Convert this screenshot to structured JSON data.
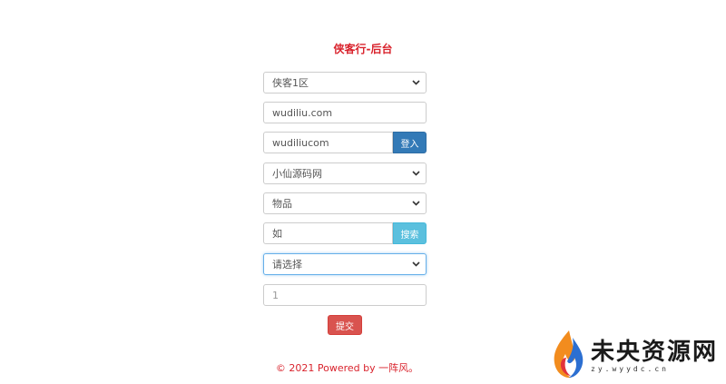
{
  "page": {
    "title": "侠客行-后台"
  },
  "form": {
    "server_select": {
      "value": "侠客1区"
    },
    "site_input": {
      "value": "wudiliu.com"
    },
    "account_input": {
      "value": "wudiliucom"
    },
    "login_button": "登入",
    "role_select": {
      "value": "小仙源码网"
    },
    "category_select": {
      "value": "物品"
    },
    "search_input": {
      "value": "如"
    },
    "search_button": "搜索",
    "item_select": {
      "value": "请选择"
    },
    "quantity_input": {
      "placeholder": "1"
    },
    "submit_button": "提交"
  },
  "footer": {
    "text": "© 2021 Powered by 一阵风。"
  },
  "watermark": {
    "title": "未央资源网",
    "subtitle": "zy.wyydc.cn"
  },
  "colors": {
    "title_red": "#d9232d",
    "login_blue": "#337ab7",
    "search_cyan": "#5bc0de",
    "submit_red": "#d9534f",
    "focus_border": "#66afe9"
  },
  "icons": {
    "select_caret": "chevron-down-icon",
    "watermark_logo": "flame-logo"
  }
}
